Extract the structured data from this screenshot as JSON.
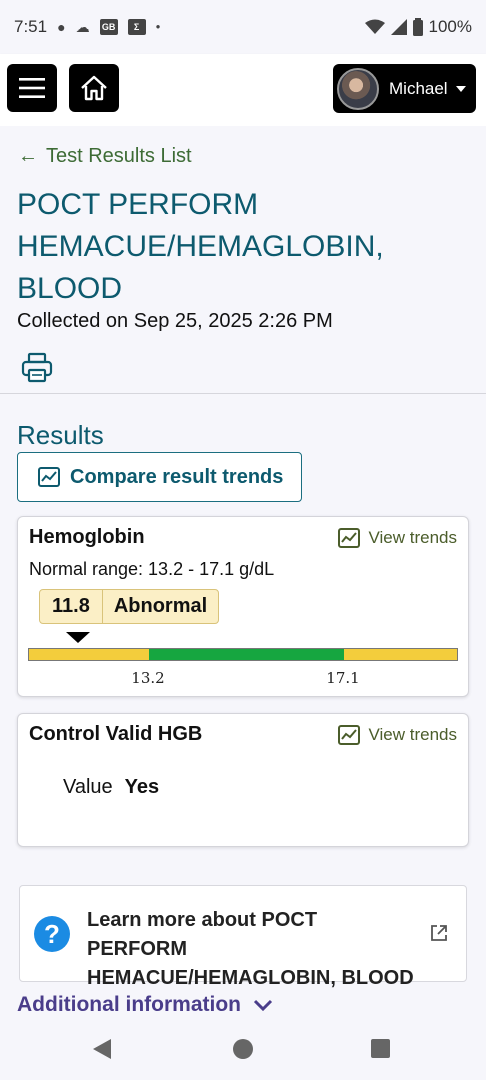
{
  "status_bar": {
    "time": "7:51",
    "notification_icons": [
      "chat-bubble-icon",
      "cloud-icon",
      "gb-icon",
      "sigma-icon",
      "dot-icon"
    ],
    "battery": "100%"
  },
  "topbar": {
    "user_name": "Michael"
  },
  "header": {
    "back_link": "Test Results List",
    "title": "POCT PERFORM HEMACUE/HEMAGLOBIN, BLOOD",
    "collected": "Collected on Sep 25, 2025 2:26 PM"
  },
  "results": {
    "heading": "Results",
    "compare_label": "Compare result trends",
    "cards": [
      {
        "title": "Hemoglobin",
        "view_trends": "View trends",
        "normal_range": "Normal range: 13.2 - 17.1 g/dL",
        "value": "11.8",
        "flag": "Abnormal",
        "range_low": 13.2,
        "range_high": 17.1,
        "tick_low": "13.2",
        "tick_high": "17.1",
        "scale_min": 10.8,
        "scale_max": 19.4,
        "colors": {
          "out_of_range": "#f3cd3c",
          "in_range": "#16a640"
        }
      },
      {
        "title": "Control Valid HGB",
        "view_trends": "View trends",
        "value_label": "Value",
        "value": "Yes"
      }
    ]
  },
  "learn_more": {
    "text": "Learn more about POCT PERFORM HEMACUE/HEMAGLOBIN, BLOOD"
  },
  "additional_info": "Additional information",
  "colors": {
    "title_teal": "#0d5a6e",
    "link_green": "#3d6b35",
    "accent_purple": "#4a3d8a",
    "help_blue": "#1b8be3"
  }
}
